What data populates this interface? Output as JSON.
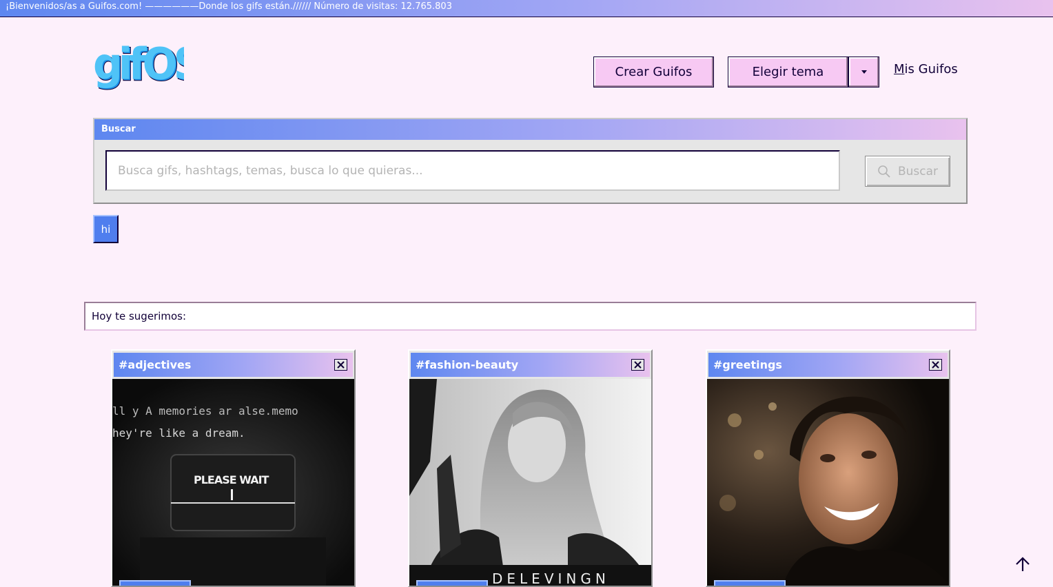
{
  "banner": {
    "text": "¡Bienvenidos/as a Guifos.com! ——————Donde los gifs están.////// Número de visitas: 12.765.803"
  },
  "header": {
    "logo_text": "gifOS",
    "create_label": "Crear Guifos",
    "theme_label": "Elegir tema",
    "my_gifs_label_first": "M",
    "my_gifs_label_rest": "is Guifos"
  },
  "search": {
    "window_title": "Buscar",
    "placeholder": "Busca gifs, hashtags, temas, busca lo que quieras...",
    "value": "",
    "button_label": "Buscar"
  },
  "tags": [
    {
      "label": "hi"
    }
  ],
  "suggestions": {
    "heading": "Hoy te sugerimos:",
    "cards": [
      {
        "title": "#adjectives",
        "image_text_1": "ll y  A memories ar  alse.memo",
        "image_text_2": "hey're like a dream.",
        "image_text_3": "PLEASE WAIT"
      },
      {
        "title": "#fashion-beauty",
        "image_text_1": "DELEVINGN"
      },
      {
        "title": "#greetings"
      }
    ]
  },
  "colors": {
    "background": "#fdf0fb",
    "accent_blue": "#5e87f0",
    "accent_pink": "#f7c9f3",
    "text_dark": "#110038"
  }
}
